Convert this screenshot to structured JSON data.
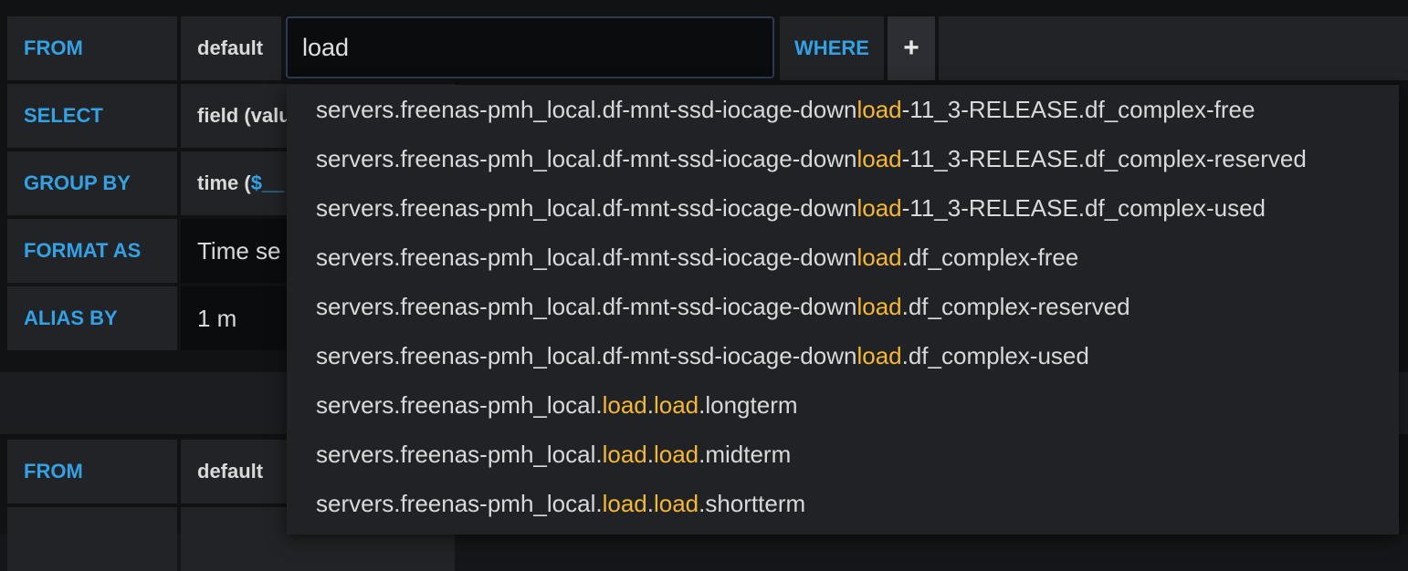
{
  "query1": {
    "from": {
      "keyword": "FROM",
      "policy": "default",
      "measurement_input": "load",
      "where_keyword": "WHERE",
      "add_label": "+"
    },
    "select": {
      "keyword": "SELECT",
      "first_segment": "field (valu"
    },
    "group_by": {
      "keyword": "GROUP BY",
      "segment_prefix": "time (",
      "segment_var": "$__"
    },
    "format_as": {
      "keyword": "FORMAT AS",
      "value": "Time se"
    },
    "alias_by": {
      "keyword": "ALIAS BY",
      "value": "1 m"
    }
  },
  "query2": {
    "from": {
      "keyword": "FROM",
      "policy": "default"
    }
  },
  "autocomplete": {
    "options": [
      {
        "before": "servers.freenas-pmh_local.df-mnt-ssd-iocage-down",
        "m1": "load",
        "mid": "-11_3-RELEASE.df_complex-free",
        "m2": "",
        "after": ""
      },
      {
        "before": "servers.freenas-pmh_local.df-mnt-ssd-iocage-down",
        "m1": "load",
        "mid": "-11_3-RELEASE.df_complex-reserved",
        "m2": "",
        "after": ""
      },
      {
        "before": "servers.freenas-pmh_local.df-mnt-ssd-iocage-down",
        "m1": "load",
        "mid": "-11_3-RELEASE.df_complex-used",
        "m2": "",
        "after": ""
      },
      {
        "before": "servers.freenas-pmh_local.df-mnt-ssd-iocage-down",
        "m1": "load",
        "mid": ".df_complex-free",
        "m2": "",
        "after": ""
      },
      {
        "before": "servers.freenas-pmh_local.df-mnt-ssd-iocage-down",
        "m1": "load",
        "mid": ".df_complex-reserved",
        "m2": "",
        "after": ""
      },
      {
        "before": "servers.freenas-pmh_local.df-mnt-ssd-iocage-down",
        "m1": "load",
        "mid": ".df_complex-used",
        "m2": "",
        "after": ""
      },
      {
        "before": "servers.freenas-pmh_local.",
        "m1": "load",
        "mid": ".",
        "m2": "load",
        "after": ".longterm"
      },
      {
        "before": "servers.freenas-pmh_local.",
        "m1": "load",
        "mid": ".",
        "m2": "load",
        "after": ".midterm"
      },
      {
        "before": "servers.freenas-pmh_local.",
        "m1": "load",
        "mid": ".",
        "m2": "load",
        "after": ".shortterm"
      }
    ]
  },
  "colors": {
    "keyword": "#33a2e5",
    "match_highlight": "#f5b82e",
    "panel": "#212326",
    "background": "#111214"
  }
}
